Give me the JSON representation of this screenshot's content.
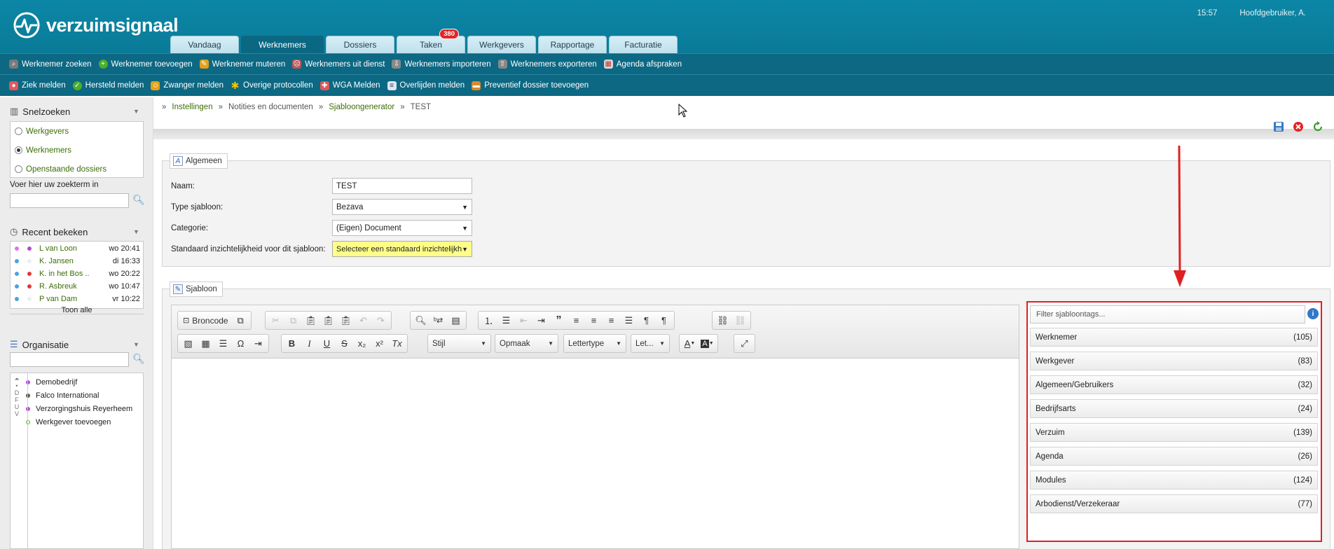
{
  "app": {
    "brand": "verzuimsignaal",
    "time": "15:57",
    "user": "Hoofdgebruiker, A."
  },
  "tabs": [
    {
      "label": "Vandaag"
    },
    {
      "label": "Werknemers",
      "active": true
    },
    {
      "label": "Dossiers"
    },
    {
      "label": "Taken",
      "badge": "380"
    },
    {
      "label": "Werkgevers"
    },
    {
      "label": "Rapportage"
    },
    {
      "label": "Facturatie"
    }
  ],
  "toolbar1": [
    "Werknemer zoeken",
    "Werknemer toevoegen",
    "Werknemer muteren",
    "Werknemers uit dienst",
    "Werknemers importeren",
    "Werknemers exporteren",
    "Agenda afspraken"
  ],
  "toolbar2": [
    "Ziek melden",
    "Hersteld melden",
    "Zwanger melden",
    "Overige protocollen",
    "WGA Melden",
    "Overlijden melden",
    "Preventief dossier toevoegen"
  ],
  "sidebar": {
    "snelzoeken": {
      "title": "Snelzoeken",
      "options": [
        "Werkgevers",
        "Werknemers",
        "Openstaande dossiers"
      ],
      "selected": "Werknemers",
      "search_label": "Voer hier uw zoekterm in"
    },
    "recent": {
      "title": "Recent bekeken",
      "items": [
        {
          "name": "L van Loon",
          "time": "wo 20:41"
        },
        {
          "name": "K. Jansen",
          "time": "di 16:33"
        },
        {
          "name": "K. in het Bos ..",
          "time": "wo 20:22"
        },
        {
          "name": "R. Asbreuk",
          "time": "wo 10:47"
        },
        {
          "name": "P van Dam",
          "time": "vr 10:22"
        }
      ],
      "show_all": "Toon alle"
    },
    "organisatie": {
      "title": "Organisatie",
      "letters": "D F U V",
      "items": [
        "Demobedrijf",
        "Falco International",
        "Verzorgingshuis Reyerheem",
        "Werkgever toevoegen"
      ]
    }
  },
  "breadcrumb": [
    "Instellingen",
    "Notities en documenten",
    "Sjabloongenerator",
    "TEST"
  ],
  "algemeen": {
    "legend": "Algemeen",
    "fields": {
      "naam": {
        "label": "Naam:",
        "value": "TEST"
      },
      "type": {
        "label": "Type sjabloon:",
        "value": "Bezava"
      },
      "categorie": {
        "label": "Categorie:",
        "value": "(Eigen) Document"
      },
      "inzicht": {
        "label": "Standaard inzichtelijkheid voor dit sjabloon:",
        "value": "Selecteer een standaard inzichtelijkh"
      }
    }
  },
  "sjabloon": {
    "legend": "Sjabloon",
    "editor": {
      "source_label": "Broncode",
      "stijl": "Stijl",
      "opmaak": "Opmaak",
      "lettertype": "Lettertype",
      "let": "Let..."
    },
    "tags": {
      "placeholder": "Filter sjabloontags...",
      "groups": [
        {
          "name": "Werknemer",
          "count": "(105)"
        },
        {
          "name": "Werkgever",
          "count": "(83)"
        },
        {
          "name": "Algemeen/Gebruikers",
          "count": "(32)"
        },
        {
          "name": "Bedrijfsarts",
          "count": "(24)"
        },
        {
          "name": "Verzuim",
          "count": "(139)"
        },
        {
          "name": "Agenda",
          "count": "(26)"
        },
        {
          "name": "Modules",
          "count": "(124)"
        },
        {
          "name": "Arbodienst/Verzekeraar",
          "count": "(77)"
        }
      ]
    }
  },
  "colors": {
    "header": "#0a7b98",
    "toolbar": "#0c6883",
    "link_green": "#3d6d08",
    "annotation_red": "#e02020"
  }
}
